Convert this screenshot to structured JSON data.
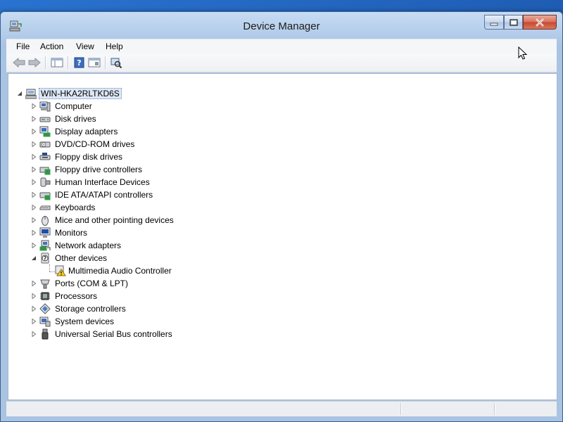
{
  "window": {
    "title": "Device Manager"
  },
  "menu": [
    "File",
    "Action",
    "View",
    "Help"
  ],
  "toolbar": {
    "buttons": [
      "back-icon",
      "forward-icon",
      "show-hide-console-tree-icon",
      "help-icon",
      "properties-icon",
      "scan-hardware-icon"
    ]
  },
  "tree": {
    "root": "WIN-HKA2RLTKD6S",
    "categories": [
      {
        "label": "Computer",
        "icon": "computer-icon"
      },
      {
        "label": "Disk drives",
        "icon": "disk-drive-icon"
      },
      {
        "label": "Display adapters",
        "icon": "display-adapter-icon"
      },
      {
        "label": "DVD/CD-ROM drives",
        "icon": "dvd-drive-icon"
      },
      {
        "label": "Floppy disk drives",
        "icon": "floppy-drive-icon"
      },
      {
        "label": "Floppy drive controllers",
        "icon": "floppy-controller-icon"
      },
      {
        "label": "Human Interface Devices",
        "icon": "hid-icon"
      },
      {
        "label": "IDE ATA/ATAPI controllers",
        "icon": "ide-controller-icon"
      },
      {
        "label": "Keyboards",
        "icon": "keyboard-icon"
      },
      {
        "label": "Mice and other pointing devices",
        "icon": "mouse-icon"
      },
      {
        "label": "Monitors",
        "icon": "monitor-icon"
      },
      {
        "label": "Network adapters",
        "icon": "network-adapter-icon"
      },
      {
        "label": "Other devices",
        "icon": "other-devices-icon",
        "expanded": true,
        "children": [
          {
            "label": "Multimedia Audio Controller",
            "icon": "warning-device-icon"
          }
        ]
      },
      {
        "label": "Ports (COM & LPT)",
        "icon": "port-icon"
      },
      {
        "label": "Processors",
        "icon": "processor-icon"
      },
      {
        "label": "Storage controllers",
        "icon": "storage-controller-icon"
      },
      {
        "label": "System devices",
        "icon": "system-devices-icon"
      },
      {
        "label": "Universal Serial Bus controllers",
        "icon": "usb-icon"
      }
    ]
  }
}
